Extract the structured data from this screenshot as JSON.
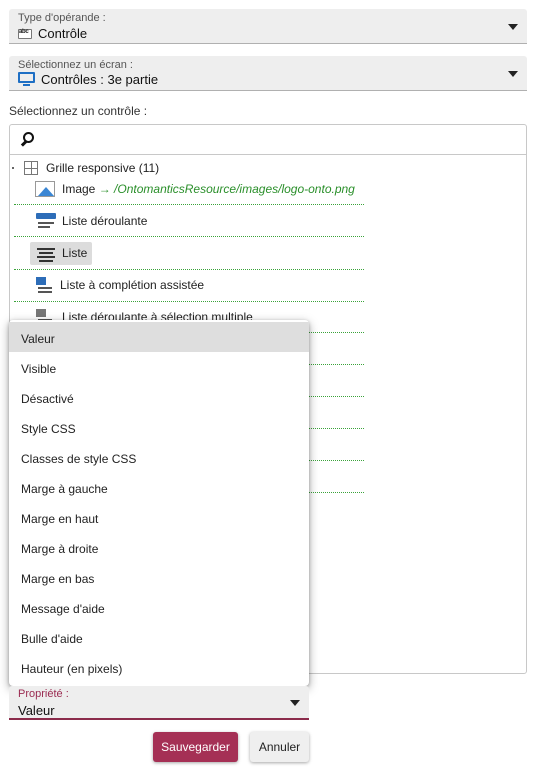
{
  "operand_select": {
    "label": "Type d'opérande :",
    "value": "Contrôle",
    "icon": "abc-field-icon"
  },
  "screen_select": {
    "label": "Sélectionnez un écran :",
    "value": "Contrôles : 3e partie",
    "icon": "monitor-icon"
  },
  "control_section": {
    "label": "Sélectionnez un contrôle :"
  },
  "search": {
    "value": "",
    "placeholder": ""
  },
  "tree": {
    "root_label": "Grille responsive (11)",
    "items": [
      {
        "label": "Image",
        "arrow": "→",
        "path": "/OntomanticsResource/images/logo-onto.png",
        "icon": "image-icon"
      },
      {
        "label": "Liste déroulante",
        "icon": "dropdown-list-icon"
      },
      {
        "label": "Liste",
        "icon": "list-icon",
        "selected": true
      },
      {
        "label": "Liste à complétion assistée",
        "icon": "autocomplete-list-icon"
      },
      {
        "label": "Liste déroulante à sélection multiple",
        "icon": "multiselect-dropdown-icon"
      }
    ]
  },
  "property_menu": {
    "items": [
      "Valeur",
      "Visible",
      "Désactivé",
      "Style CSS",
      "Classes de style CSS",
      "Marge à gauche",
      "Marge en haut",
      "Marge à droite",
      "Marge en bas",
      "Message d'aide",
      "Bulle d'aide",
      "Hauteur (en pixels)"
    ],
    "active_index": 0
  },
  "property_select": {
    "label": "Propriété :",
    "value": "Valeur"
  },
  "buttons": {
    "save": "Sauvegarder",
    "cancel": "Annuler"
  },
  "colors": {
    "accent": "#a53055",
    "link_green": "#2a8f2a",
    "icon_blue": "#2d6db8"
  }
}
